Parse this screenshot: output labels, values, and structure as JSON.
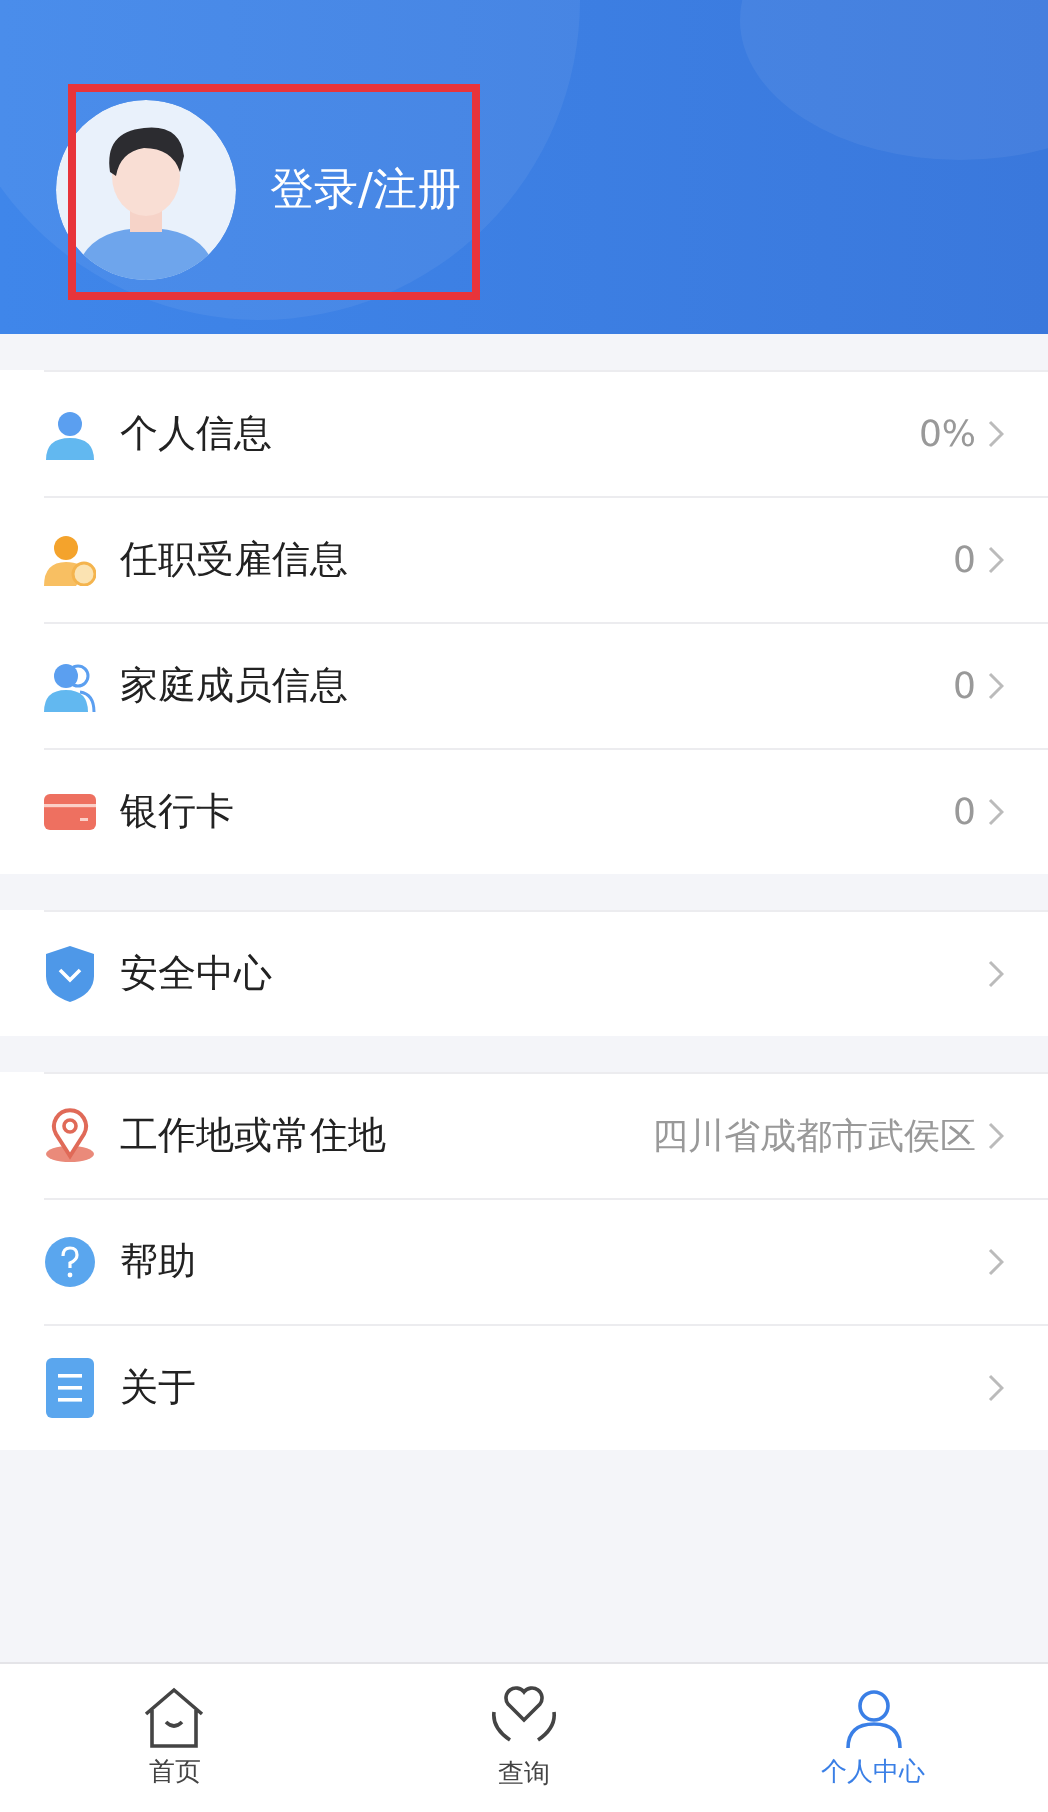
{
  "header": {
    "login": {
      "label": "登录/注册",
      "highlighted": true
    }
  },
  "groups": [
    {
      "items": [
        {
          "label": "个人信息",
          "value": "0%"
        },
        {
          "label": "任职受雇信息",
          "value": "0"
        },
        {
          "label": "家庭成员信息",
          "value": "0"
        },
        {
          "label": "银行卡",
          "value": "0"
        }
      ]
    },
    {
      "items": [
        {
          "label": "安全中心"
        }
      ]
    },
    {
      "items": [
        {
          "label": "工作地或常住地",
          "value": "四川省成都市武侯区"
        },
        {
          "label": "帮助"
        },
        {
          "label": "关于"
        }
      ]
    }
  ],
  "tab_bar": [
    {
      "label": "首页",
      "selected": false
    },
    {
      "label": "查询",
      "selected": false
    },
    {
      "label": "个人中心",
      "selected": true
    }
  ]
}
